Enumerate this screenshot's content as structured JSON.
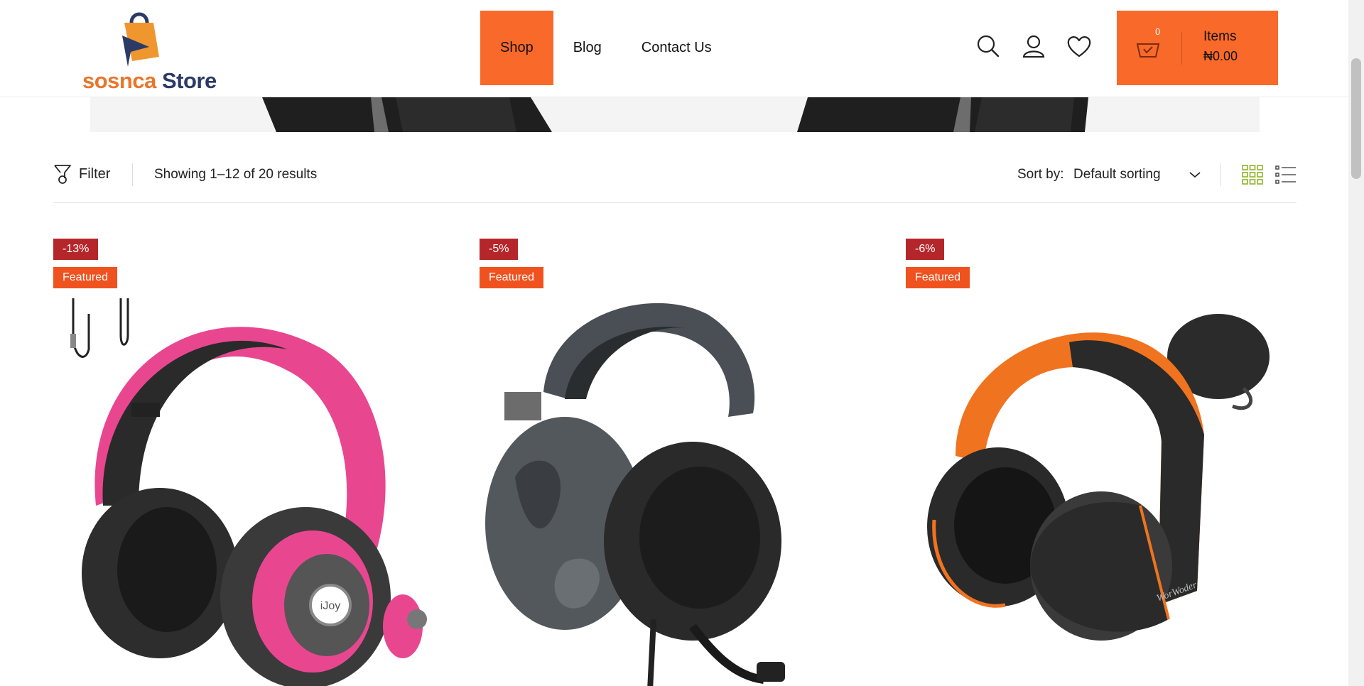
{
  "brand": {
    "name_part1": "sosnca",
    "name_part2": " Store"
  },
  "nav": {
    "items": [
      {
        "label": "Shop"
      },
      {
        "label": "Blog"
      },
      {
        "label": "Contact Us"
      }
    ]
  },
  "header_icons": [
    "search-icon",
    "user-icon",
    "heart-icon"
  ],
  "cart": {
    "count": "0",
    "label": "Items",
    "total": "₦0.00"
  },
  "toolbar": {
    "filter_label": "Filter",
    "results_text": "Showing 1–12 of 20 results",
    "sort_label": "Sort by:",
    "sort_value": "Default sorting"
  },
  "products": [
    {
      "discount": "-13%",
      "featured": "Featured"
    },
    {
      "discount": "-5%",
      "featured": "Featured"
    },
    {
      "discount": "-6%",
      "featured": "Featured"
    }
  ],
  "colors": {
    "accent": "#f9692a",
    "sale_badge": "#b5262b",
    "featured_badge": "#f0521f",
    "view_active": "#9bbb3a"
  }
}
